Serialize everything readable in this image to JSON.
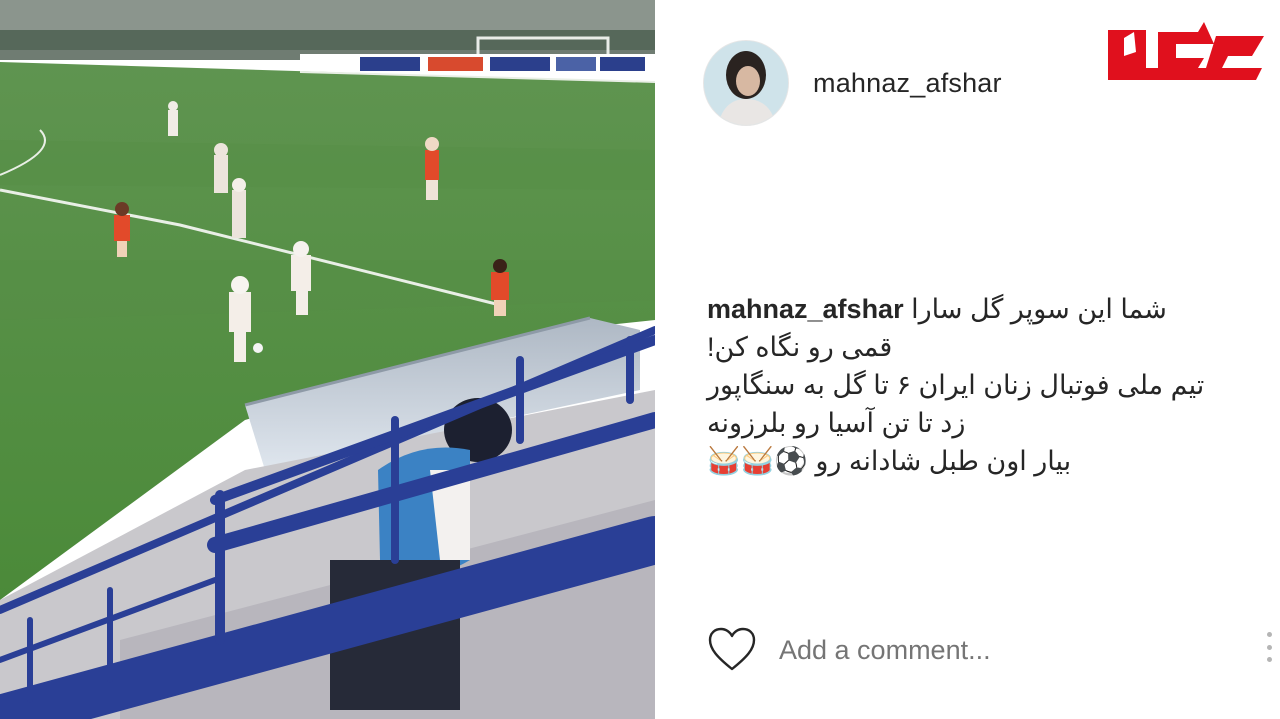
{
  "post": {
    "username": "mahnaz_afshar",
    "avatar_alt": "profile-photo",
    "caption_user": "mahnaz_afshar",
    "caption_first": "شما این سوپر گل سارا",
    "caption_lines": [
      "قمی رو نگاه کن!",
      "تیم ملی فوتبال زنان ایران ۶ تا گل به سنگاپور",
      "زد تا تن آسیا رو بلرزونه",
      "بیار اون طبل شادانه رو ⚽️🥁🥁"
    ]
  },
  "actions": {
    "like_icon": "heart-icon",
    "comment_placeholder": "Add a comment...",
    "more_icon": "more-options-icon"
  },
  "brand": {
    "logo_icon": "site-logo",
    "logo_color": "#e0101d"
  },
  "colors": {
    "text": "#262626",
    "placeholder": "#9a9a9a",
    "pitch": "#4f8a3c",
    "stand_blue": "#2a3f96"
  }
}
